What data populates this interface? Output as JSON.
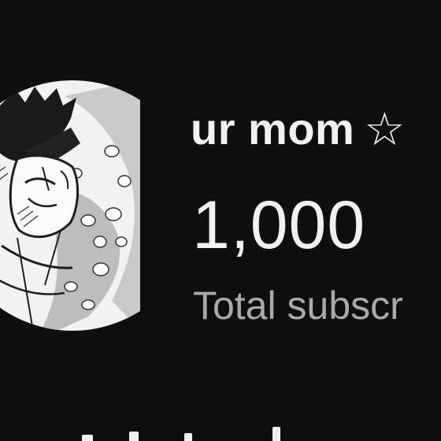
{
  "channel": {
    "name": "ur mom",
    "name_icon": "star-outline-icon",
    "name_icon_glyph": "☆",
    "subscriber_count": "1,000",
    "subscriber_label": "Total subscr"
  },
  "avatar": {
    "icon": "manga-avatar-image"
  },
  "colors": {
    "background": "#0f0f0f",
    "primary_text": "#f1f1f1",
    "secondary_text": "#aaaaaa"
  }
}
